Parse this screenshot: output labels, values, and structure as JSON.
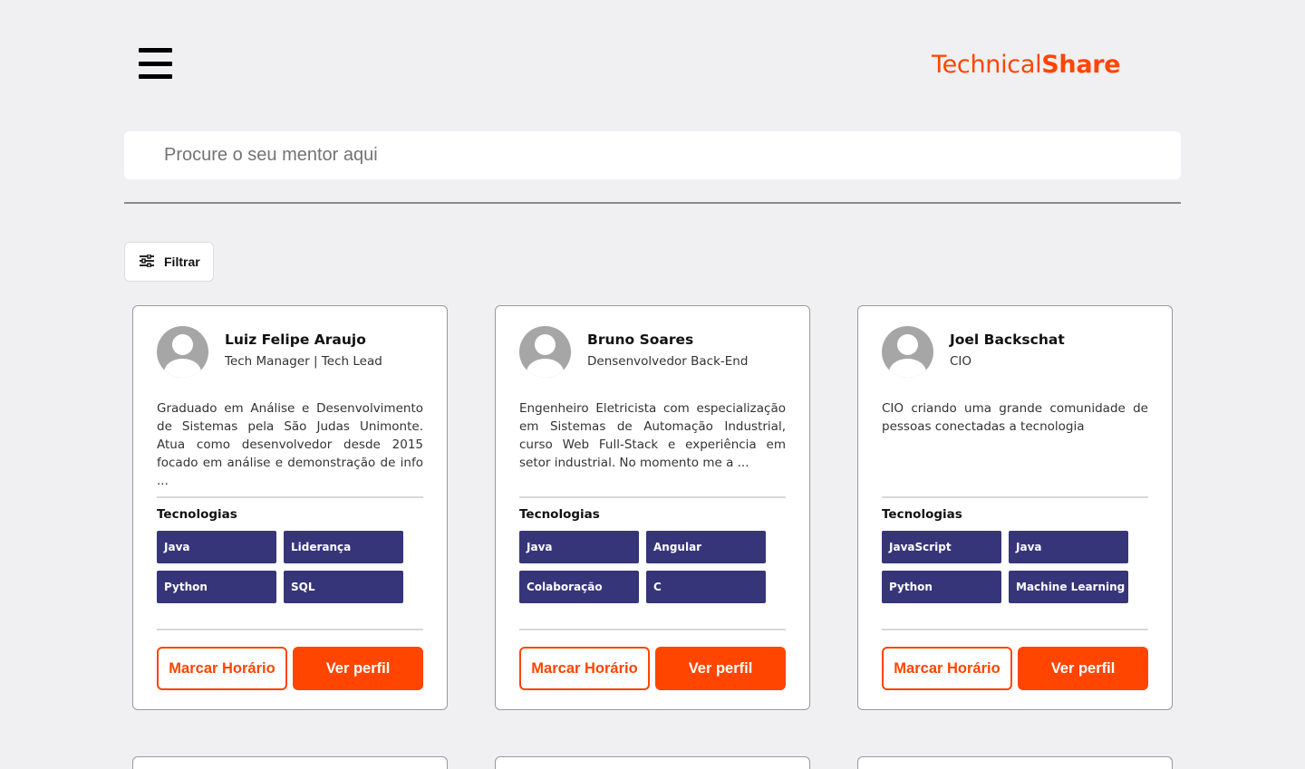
{
  "header": {
    "logo_light": "Technical",
    "logo_bold": "Share"
  },
  "search": {
    "placeholder": "Procure o seu mentor aqui"
  },
  "filter": {
    "label": "Filtrar"
  },
  "tech_heading": "Tecnologias",
  "buttons": {
    "schedule": "Marcar Horário",
    "profile": "Ver perfil"
  },
  "mentors": [
    {
      "name": "Luiz Felipe Araujo",
      "role": "Tech Manager | Tech Lead",
      "description": "Graduado em Análise e Desenvolvimento de Sistemas pela São Judas Unimonte. Atua como desenvolvedor desde 2015 focado em análise e demonstração de info ...",
      "tags": [
        "Java",
        "Liderança",
        "Python",
        "SQL"
      ]
    },
    {
      "name": "Bruno Soares",
      "role": "Densenvolvedor Back-End",
      "description": "Engenheiro Eletricista com especialização em Sistemas de Automação Industrial, curso Web Full-Stack e experiência em setor industrial. No momento me a ...",
      "tags": [
        "Java",
        "Angular",
        "Colaboração",
        "C"
      ]
    },
    {
      "name": "Joel Backschat",
      "role": "CIO",
      "description": "CIO criando uma grande comunidade de pessoas conectadas a tecnologia",
      "tags": [
        "JavaScript",
        "Java",
        "Python",
        "Machine Learning"
      ]
    }
  ],
  "colors": {
    "accent": "#ff4500",
    "tag": "#36357a",
    "background": "#f0f0f2"
  }
}
